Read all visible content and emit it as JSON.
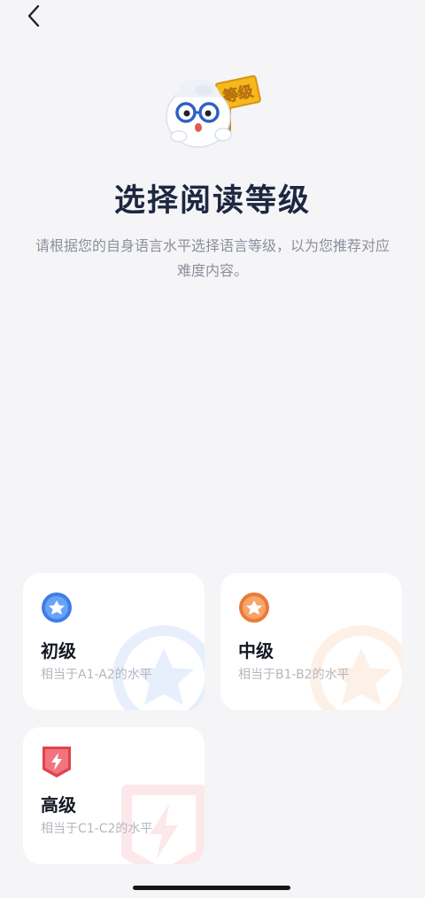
{
  "header": {
    "back_icon": "chevron-left-icon"
  },
  "mascot": {
    "sign_text": "等级"
  },
  "title": "选择阅读等级",
  "description": "请根据您的自身语言水平选择语言等级，以为您推荐对应难度内容。",
  "levels": [
    {
      "name": "初级",
      "desc": "相当于A1-A2的水平",
      "color": "#4a86f0",
      "icon": "star-badge-icon"
    },
    {
      "name": "中级",
      "desc": "相当于B1-B2的水平",
      "color": "#f08a4b",
      "icon": "star-badge-icon"
    },
    {
      "name": "高级",
      "desc": "相当于C1-C2的水平",
      "color": "#e8505b",
      "icon": "lightning-shield-icon"
    }
  ]
}
